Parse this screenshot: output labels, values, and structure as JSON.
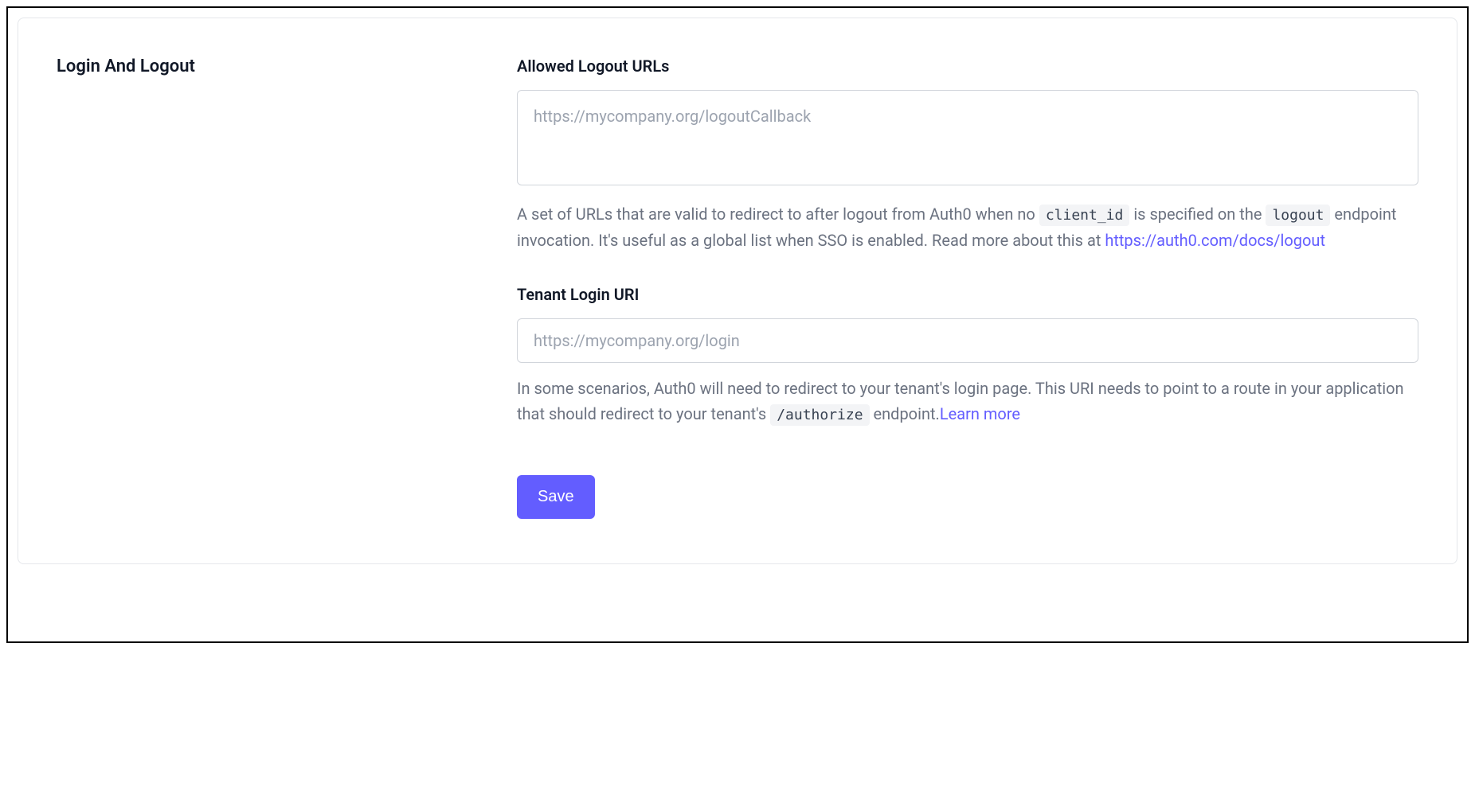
{
  "section": {
    "title": "Login And Logout"
  },
  "fields": {
    "allowed_logout_urls": {
      "label": "Allowed Logout URLs",
      "placeholder": "https://mycompany.org/logoutCallback",
      "help_pre": "A set of URLs that are valid to redirect to after logout from Auth0 when no ",
      "code1": "client_id",
      "help_mid1": " is specified on the ",
      "code2": "logout",
      "help_mid2": " endpoint invocation. It's useful as a global list when SSO is enabled. Read more about this at ",
      "link_text": "https://auth0.com/docs/logout"
    },
    "tenant_login_uri": {
      "label": "Tenant Login URI",
      "placeholder": "https://mycompany.org/login",
      "help_pre": "In some scenarios, Auth0 will need to redirect to your tenant's login page. This URI needs to point to a route in your application that should redirect to your tenant's ",
      "code1": "/authorize",
      "help_mid1": " endpoint.",
      "link_text": "Learn more"
    }
  },
  "actions": {
    "save_label": "Save"
  }
}
